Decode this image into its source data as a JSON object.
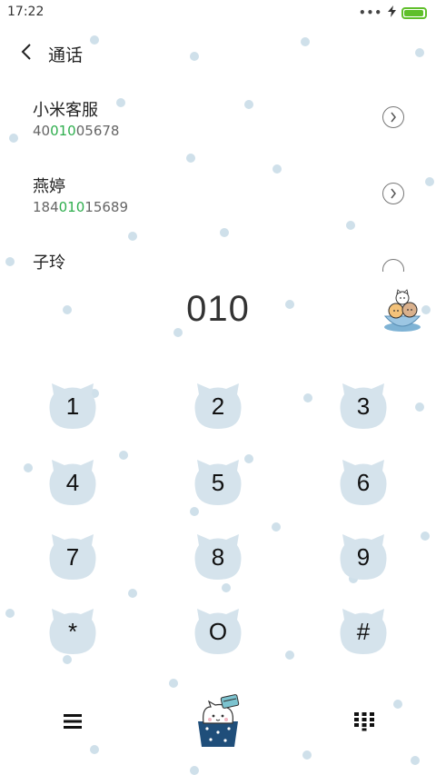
{
  "status_bar": {
    "time": "17:22",
    "more_indicator": "•••",
    "charging_icon": "bolt-icon",
    "battery_color": "#5fbf2a",
    "battery_level": 0.95
  },
  "header": {
    "back_icon": "chevron-left-icon",
    "title": "通话"
  },
  "contacts": [
    {
      "name": "小米客服",
      "number_prefix": "40",
      "number_match": "010",
      "number_suffix": "05678"
    },
    {
      "name": "燕婷",
      "number_prefix": "184",
      "number_match": "010",
      "number_suffix": "15689"
    },
    {
      "name": "子玲",
      "number_prefix": "",
      "number_match": "",
      "number_suffix": ""
    }
  ],
  "highlight_color": "#2fae4e",
  "dialed_number": "010",
  "keypad": {
    "k1": "1",
    "k2": "2",
    "k3": "3",
    "k4": "4",
    "k5": "5",
    "k6": "6",
    "k7": "7",
    "k8": "8",
    "k9": "9",
    "kstar": "*",
    "k0": "O",
    "khash": "#"
  },
  "key_color": "#d5e3ec",
  "bottom_bar": {
    "menu_icon": "menu-icon",
    "call_icon": "cat-gift-icon",
    "keypad_icon": "keypad-icon"
  }
}
